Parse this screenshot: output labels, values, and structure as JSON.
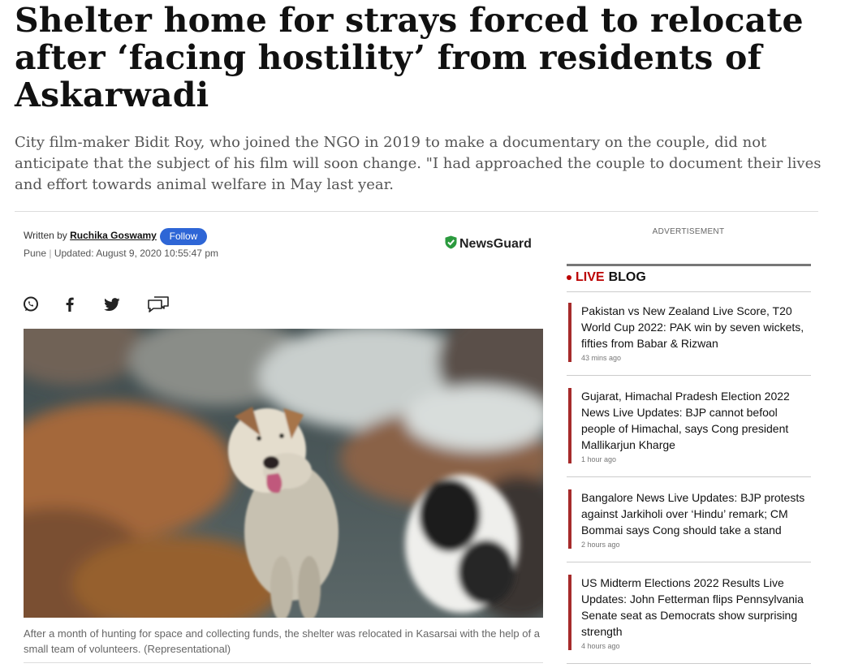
{
  "article": {
    "headline": "Shelter home for strays forced to relocate after ‘facing hostility’ from residents of Askarwadi",
    "synopsis": "City film-maker Bidit Roy, who joined the NGO in 2019 to make a documentary on the couple, did not anticipate that the subject of his film will soon change. \"I had approached the couple to document their lives and effort towards animal welfare in May last year.",
    "byline_prefix": "Written by ",
    "author": "Ruchika Goswamy",
    "follow_label": "Follow",
    "location": "Pune",
    "separator": " | ",
    "updated": "Updated: August 9, 2020 10:55:47 pm",
    "newsguard_label": "NewsGuard",
    "caption": "After a month of hunting for space and collecting funds, the shelter was relocated in Kasarsai with the help of a small team of volunteers. (Representational)"
  },
  "share": {
    "whatsapp_icon": "whatsapp-icon",
    "facebook_icon": "facebook-icon",
    "twitter_icon": "twitter-icon",
    "comments_icon": "comments-icon"
  },
  "sidebar": {
    "advertisement": "ADVERTISEMENT",
    "live_label": "LIVE",
    "blog_label": "BLOG",
    "items": [
      {
        "title": "Pakistan vs New Zealand Live Score, T20 World Cup 2022: PAK win by seven wickets, fifties from Babar & Rizwan",
        "time": "43 mins ago"
      },
      {
        "title": "Gujarat, Himachal Pradesh Election 2022 News Live Updates: BJP cannot befool people of Himachal, says Cong president Mallikarjun Kharge",
        "time": "1 hour ago"
      },
      {
        "title": "Bangalore News Live Updates: BJP protests against Jarkiholi over ‘Hindu’ remark; CM Bommai says Cong should take a stand",
        "time": "2 hours ago"
      },
      {
        "title": "US Midterm Elections 2022 Results Live Updates: John Fetterman flips Pennsylvania Senate seat as Democrats show surprising strength",
        "time": "4 hours ago"
      }
    ]
  },
  "colors": {
    "follow_button": "#2e66d6",
    "live_red": "#bb0000",
    "newsguard_green": "#2b9a3e",
    "liveblog_border": "#a62b2b"
  }
}
